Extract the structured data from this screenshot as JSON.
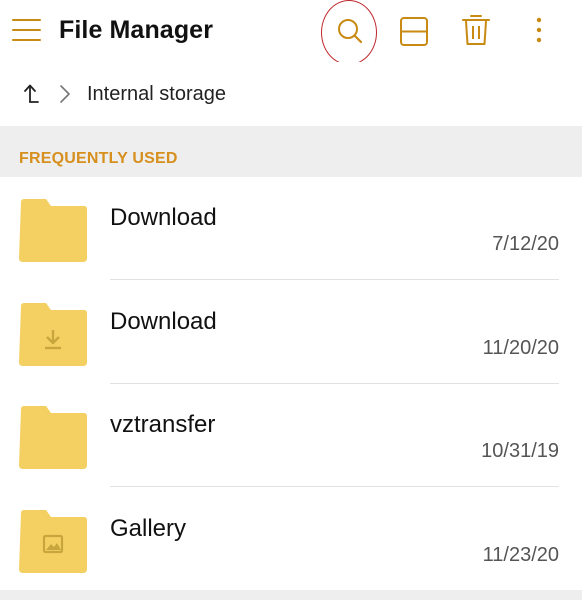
{
  "app": {
    "title": "File Manager"
  },
  "toolbar": {
    "menu_icon": "hamburger-menu-icon",
    "search_icon": "search-icon",
    "split_icon": "split-view-icon",
    "delete_icon": "trash-icon",
    "more_icon": "more-vert-icon",
    "accent_color": "#c88a12",
    "highlight_color": "#c0282d"
  },
  "breadcrumb": {
    "up_icon": "up-arrow-icon",
    "separator_icon": "chevron-right-icon",
    "current": "Internal storage"
  },
  "section": {
    "label": "FREQUENTLY USED",
    "color": "#d78f1e"
  },
  "items": [
    {
      "name": "Download",
      "date": "7/12/20",
      "icon": "folder-icon"
    },
    {
      "name": "Download",
      "date": "11/20/20",
      "icon": "folder-download-icon"
    },
    {
      "name": "vztransfer",
      "date": "10/31/19",
      "icon": "folder-icon"
    },
    {
      "name": "Gallery",
      "date": "11/23/20",
      "icon": "folder-image-icon"
    }
  ],
  "colors": {
    "folder": "#f4d063",
    "folder_glyph": "#c9a53e"
  }
}
